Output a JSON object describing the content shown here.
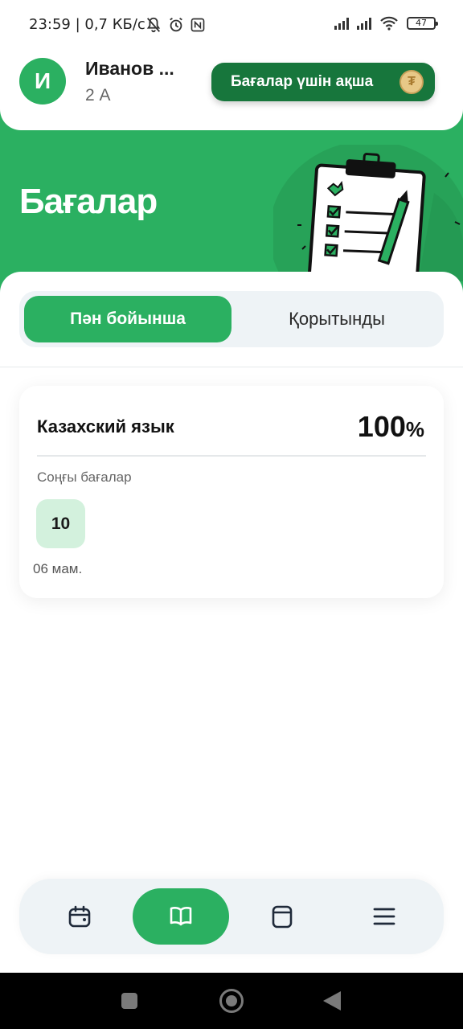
{
  "status_bar": {
    "time_speed": "23:59 | 0,7 КБ/с",
    "battery": "47"
  },
  "header": {
    "avatar_letter": "И",
    "user_name": "Иванов ...",
    "user_class": "2 А",
    "money_button_label": "Бағалар үшін ақша",
    "coin_symbol": "₮"
  },
  "page": {
    "title": "Бағалар"
  },
  "tabs": [
    {
      "label": "Пән бойынша",
      "active": true
    },
    {
      "label": "Қорытынды",
      "active": false
    }
  ],
  "subject_card": {
    "subject": "Казахский язык",
    "percent_value": "100",
    "percent_sign": "%",
    "recent_label": "Соңғы бағалар",
    "grades": [
      {
        "value": "10",
        "date": "06 мам."
      }
    ]
  },
  "bottom_nav": {
    "items": [
      {
        "icon": "calendar-icon",
        "active": false
      },
      {
        "icon": "book-icon",
        "active": true
      },
      {
        "icon": "tablet-icon",
        "active": false
      },
      {
        "icon": "menu-icon",
        "active": false
      }
    ]
  },
  "colors": {
    "brand_green": "#2bb061",
    "dark_green": "#17763c",
    "grade_bg": "#d3f1dd",
    "nav_bg": "#eef3f6"
  }
}
